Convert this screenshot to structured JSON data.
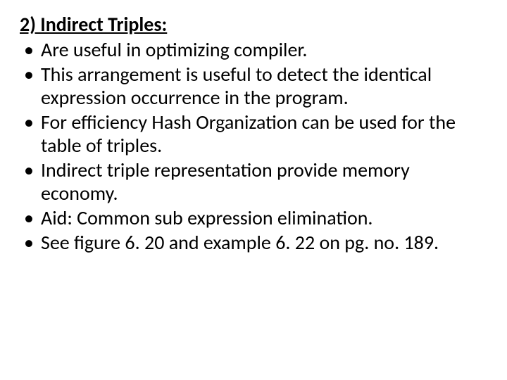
{
  "heading": "2) Indirect Triples:",
  "bullets": [
    "Are useful in optimizing compiler.",
    "This arrangement is useful to detect the identical expression occurrence in the program.",
    "For efficiency Hash Organization can be used for the table of triples.",
    "Indirect triple representation provide memory economy.",
    "Aid: Common sub expression elimination.",
    "See figure 6. 20 and example 6. 22 on pg. no. 189."
  ]
}
